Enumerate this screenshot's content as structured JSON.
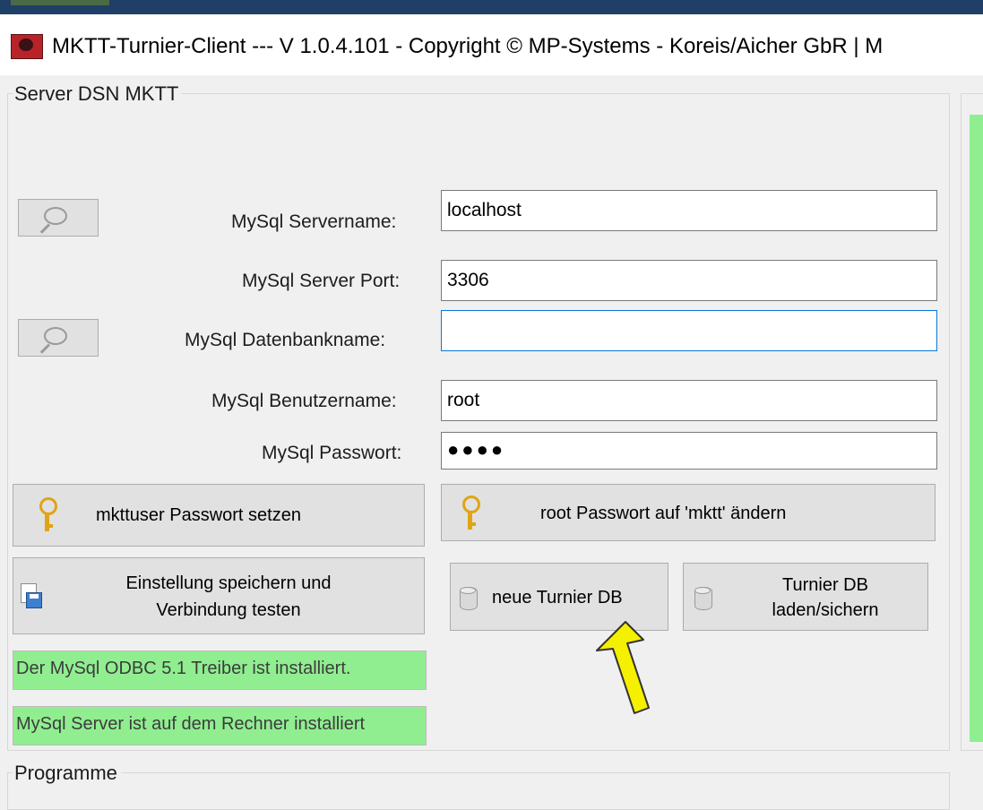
{
  "window": {
    "title": "MKTT-Turnier-Client  --- V 1.0.4.101 - Copyright © MP-Systems - Koreis/Aicher GbR | M"
  },
  "server_group": {
    "label": "Server DSN MKTT",
    "servername_label": "MySql Servername:",
    "servername_value": "localhost",
    "port_label": "MySql Server Port:",
    "port_value": "3306",
    "dbname_label": "MySql Datenbankname:",
    "dbname_value": "",
    "username_label": "MySql Benutzername:",
    "username_value": "root",
    "password_label": "MySql Passwort:",
    "password_display": "●●●●"
  },
  "buttons": {
    "mkttuser_password": "mkttuser Passwort setzen",
    "root_password": "root Passwort auf 'mktt' ändern",
    "save_test_line1": "Einstellung speichern und",
    "save_test_line2": "Verbindung testen",
    "new_db": "neue Turnier DB",
    "load_save_line1": "Turnier DB",
    "load_save_line2": "laden/sichern"
  },
  "status": {
    "odbc": "Der MySql ODBC 5.1 Treiber ist installiert.",
    "server": "MySql Server ist auf dem Rechner installiert"
  },
  "programs_group": {
    "label": "Programme"
  },
  "colors": {
    "status_green": "#90ee90",
    "arrow_yellow": "#f5f000",
    "focus_blue": "#0a78d7"
  }
}
